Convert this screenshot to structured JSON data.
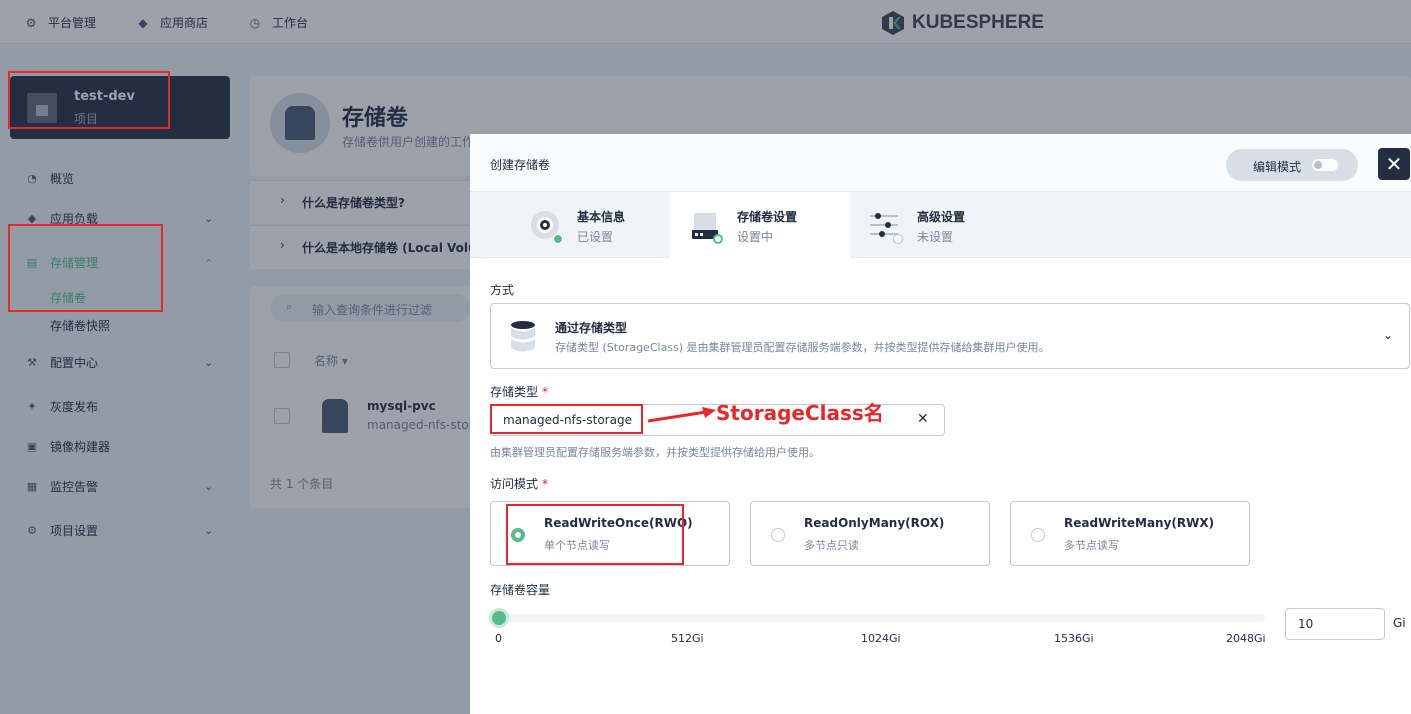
{
  "topnav": {
    "items": [
      {
        "label": "平台管理",
        "icon": "gear-icon"
      },
      {
        "label": "应用商店",
        "icon": "stack-icon"
      },
      {
        "label": "工作台",
        "icon": "clock-icon"
      }
    ],
    "logo": "KUBESPHERE"
  },
  "project": {
    "name": "test-dev",
    "type": "项目"
  },
  "sidebar": {
    "items": [
      {
        "label": "概览",
        "icon": "dashboard-icon"
      },
      {
        "label": "应用负载",
        "icon": "stack-icon"
      },
      {
        "label": "存储管理",
        "icon": "database-icon",
        "active": true
      },
      {
        "label": "存储卷",
        "sub": true,
        "active": true
      },
      {
        "label": "存储卷快照",
        "sub": true
      },
      {
        "label": "配置中心",
        "icon": "wrench-icon"
      },
      {
        "label": "灰度发布",
        "icon": "bird-icon"
      },
      {
        "label": "镜像构建器",
        "icon": "image-icon"
      },
      {
        "label": "监控告警",
        "icon": "monitor-icon"
      },
      {
        "label": "项目设置",
        "icon": "gear-icon"
      }
    ]
  },
  "main": {
    "title": "存储卷",
    "desc": "存储卷供用户创建的工作负载使用",
    "faq": [
      "什么是存储卷类型?",
      "什么是本地存储卷 (Local Volume)?"
    ],
    "search_placeholder": "输入查询条件进行过滤",
    "col_name": "名称",
    "row": {
      "name": "mysql-pvc",
      "sub": "managed-nfs-storage"
    },
    "total": "共 1 个条目"
  },
  "modal": {
    "title": "创建存储卷",
    "edit_mode": "编辑模式",
    "close": "✕",
    "steps": [
      {
        "title": "基本信息",
        "status": "已设置"
      },
      {
        "title": "存储卷设置",
        "status": "设置中"
      },
      {
        "title": "高级设置",
        "status": "未设置"
      }
    ],
    "method_label": "方式",
    "method": {
      "title": "通过存储类型",
      "desc": "存储类型 (StorageClass) 是由集群管理员配置存储服务端参数，并按类型提供存储给集群用户使用。"
    },
    "storage_class_label": "存储类型",
    "storage_class_value": "managed-nfs-storage",
    "storage_class_hint": "由集群管理员配置存储服务端参数，并按类型提供存储给用户使用。",
    "access_mode_label": "访问模式",
    "access_modes": [
      {
        "title": "ReadWriteOnce(RWO)",
        "sub": "单个节点读写",
        "selected": true
      },
      {
        "title": "ReadOnlyMany(ROX)",
        "sub": "多节点只读",
        "selected": false
      },
      {
        "title": "ReadWriteMany(RWX)",
        "sub": "多节点读写",
        "selected": false
      }
    ],
    "capacity_label": "存储卷容量",
    "slider_ticks": [
      "0",
      "512Gi",
      "1024Gi",
      "1536Gi",
      "2048Gi"
    ],
    "slider_fraction": 0.005,
    "capacity_value": "10",
    "capacity_unit": "Gi"
  },
  "annotation": {
    "text": "StorageClass名",
    "color": "#e5292b"
  },
  "colors": {
    "accent": "#55bc8a",
    "dark": "#242e42",
    "annotation_red": "#e5292b"
  }
}
